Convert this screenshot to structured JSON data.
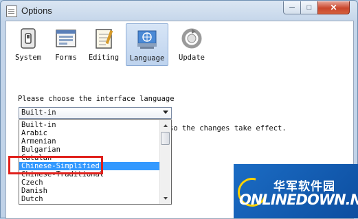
{
  "window": {
    "title": "Options"
  },
  "toolbar": {
    "tabs": [
      {
        "label": "System",
        "icon": "switch-icon"
      },
      {
        "label": "Forms",
        "icon": "form-icon"
      },
      {
        "label": "Editing",
        "icon": "notepad-icon"
      },
      {
        "label": "Language",
        "icon": "globe-flag-icon",
        "active": true
      },
      {
        "label": "Update",
        "icon": "update-icon"
      }
    ]
  },
  "language": {
    "prompt": "Please choose the interface language",
    "selected": "Built-in",
    "note": "so the changes take effect.",
    "options": [
      "Built-in",
      "Arabic",
      "Armenian",
      "Bulgarian",
      "Catalan",
      "Chinese-Simplified",
      "Chinese-Traditional",
      "Czech",
      "Danish",
      "Dutch"
    ],
    "highlighted": "Chinese-Simplified"
  },
  "watermark": {
    "cn": "华军软件园",
    "en": "ONLINEDOWN.NET"
  },
  "colors": {
    "selection": "#3399ff",
    "annotation": "#e0201b",
    "watermark": "#1b6cc4"
  }
}
